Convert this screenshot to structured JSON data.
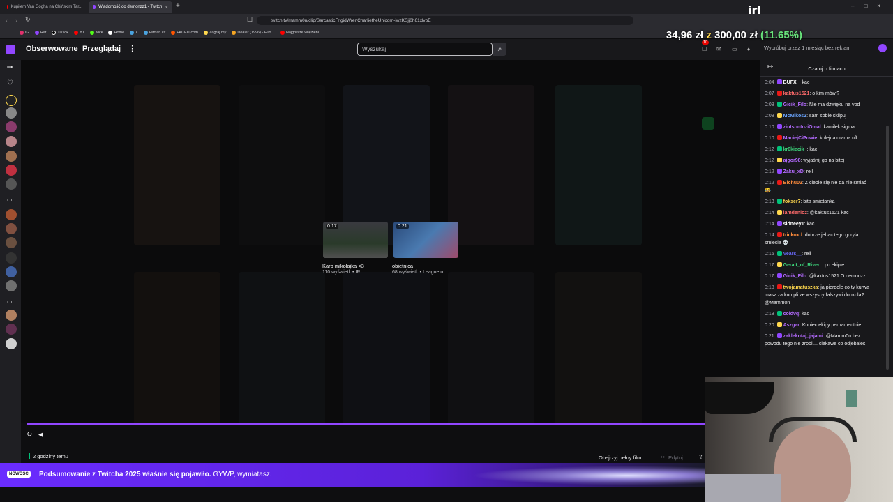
{
  "browser": {
    "tabs": [
      {
        "label": "Kupiłem Van Gogha na Chińskim Tar..."
      },
      {
        "label": "Wiadomość do demonzz1 - Twitch"
      }
    ],
    "url": "twitch.tv/mamm0n/clip/SarcasticFrigidWrenCharlietheUnicorn-iwzKSjj0h61xlvbE",
    "bookmarks": [
      "IG",
      "Rat",
      "TikTok",
      "YT",
      "Kick",
      "Home",
      "X",
      "Filman.cc",
      "FACEIT.com",
      "Zagraj.my",
      "Dealer (1996) - Film...",
      "Najgorsze Więzieni..."
    ]
  },
  "overlay": {
    "money_current": "34,96 zł",
    "money_z": "z",
    "money_target": "300,00 zł",
    "money_pct": "(11.65%)",
    "irl_logo": "irl"
  },
  "topnav": {
    "following": "Obserwowane",
    "browse": "Przeglądaj",
    "search_placeholder": "Wyszukaj",
    "notif_count": "10",
    "promo": "Wypróbuj przez 1 miesiąc bez reklam"
  },
  "clips": [
    {
      "duration": "0:17",
      "title": "Karo mikolajka <3",
      "meta": "110 wyświetl. • IRL"
    },
    {
      "duration": "0:21",
      "title": "obietnica",
      "meta": "68 wyświetl. • League o..."
    }
  ],
  "player": {
    "time_ago": "2 godziny temu",
    "watch_full": "Obejrzyj pełny film",
    "edit": "Edytuj"
  },
  "banner": {
    "badge": "NOWOŚĆ",
    "text_bold": "Podsumowanie z Twitcha 2025 właśnie się pojawiło.",
    "text_rest": "GYWP, wymiatasz."
  },
  "chat": {
    "title": "Czatuj o filmach",
    "messages": [
      {
        "time": "0:04",
        "user": "BUFX_",
        "color": "#ffffff",
        "text": ": kac"
      },
      {
        "time": "0:07",
        "user": "kaktus1521",
        "color": "#ff6b6b",
        "text": ": o kim mówi?"
      },
      {
        "time": "0:08",
        "user": "Gicik_Filo",
        "color": "#b46bff",
        "text": ": Nie ma dźwięku na vod"
      },
      {
        "time": "0:08",
        "user": "McMikos2",
        "color": "#6ba5ff",
        "text": ": sam sobie skilpuj"
      },
      {
        "time": "0:10",
        "user": "ziutsontoziOmal",
        "color": "#b46bff",
        "text": ": kamilek sigma"
      },
      {
        "time": "0:10",
        "user": "MaciejCiPowie",
        "color": "#b46bff",
        "text": ": kolejna drama uff"
      },
      {
        "time": "0:12",
        "user": "kr0kiecik_",
        "color": "#3cd17a",
        "text": ": kac"
      },
      {
        "time": "0:12",
        "user": "ajgor98",
        "color": "#b46bff",
        "text": ": wyjaśnij go na bitej"
      },
      {
        "time": "0:12",
        "user": "Zaku_xD",
        "color": "#b46bff",
        "text": ": rell"
      },
      {
        "time": "0:12",
        "user": "Bichu02",
        "color": "#ff8c3c",
        "text": ": Z ciebie się nie da nie śmiać 😂"
      },
      {
        "time": "0:13",
        "user": "fokser7",
        "color": "#ffd84d",
        "text": ": bita smietanka"
      },
      {
        "time": "0:14",
        "user": "iamdenioz",
        "color": "#ff6b6b",
        "text": ": @kaktus1521 kac"
      },
      {
        "time": "0:14",
        "user": "sidneey1",
        "color": "#ffffff",
        "text": ": kac"
      },
      {
        "time": "0:14",
        "user": "trickoxd",
        "color": "#ff8c3c",
        "text": ": dobrze jebac tego goryla smiecia 💀"
      },
      {
        "time": "0:15",
        "user": "Vears__",
        "color": "#6b6bff",
        "text": ": rell"
      },
      {
        "time": "0:17",
        "user": "Geralt_of_River",
        "color": "#3cd17a",
        "text": ": i po ekipie"
      },
      {
        "time": "0:17",
        "user": "Gicik_Filo",
        "color": "#b46bff",
        "text": ": @kaktus1521 O demonzz"
      },
      {
        "time": "0:18",
        "user": "twojamatuszka",
        "color": "#ffd84d",
        "text": ": ja pierdole co ty kurwa masz za kumpli ze wszyscy falszywi dookola? @Mamm0n"
      },
      {
        "time": "0:18",
        "user": "coldvq",
        "color": "#b46bff",
        "text": ": kac"
      },
      {
        "time": "0:20",
        "user": "Aszgar",
        "color": "#b46bff",
        "text": ": Koniec ekipy pernamentnie"
      },
      {
        "time": "0:21",
        "user": "zaklekotaj_jajami",
        "color": "#b46bff",
        "text": ": @Mamm0n bez powodu tego nie zrobil... ciekawe co odjebales"
      }
    ]
  }
}
